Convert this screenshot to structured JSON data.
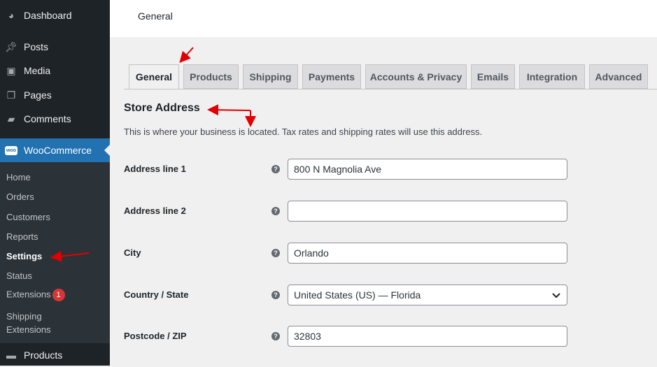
{
  "sidebar": {
    "menu": [
      {
        "label": "Dashboard",
        "icon": "dashboard-icon"
      },
      {
        "label": "Posts",
        "icon": "pin-icon"
      },
      {
        "label": "Media",
        "icon": "media-icon"
      },
      {
        "label": "Pages",
        "icon": "pages-icon"
      },
      {
        "label": "Comments",
        "icon": "comment-icon"
      },
      {
        "label": "WooCommerce",
        "icon": "woo-icon"
      }
    ],
    "submenu": [
      {
        "label": "Home"
      },
      {
        "label": "Orders"
      },
      {
        "label": "Customers"
      },
      {
        "label": "Reports"
      },
      {
        "label": "Settings"
      },
      {
        "label": "Status"
      },
      {
        "label": "Extensions",
        "badge": "1"
      },
      {
        "label": "Shipping Extensions"
      }
    ],
    "products": {
      "label": "Products",
      "icon": "archive-icon"
    },
    "active_color": "#2271b1"
  },
  "header": {
    "title": "General"
  },
  "tabs": [
    {
      "label": "General"
    },
    {
      "label": "Products"
    },
    {
      "label": "Shipping"
    },
    {
      "label": "Payments"
    },
    {
      "label": "Accounts & Privacy"
    },
    {
      "label": "Emails"
    },
    {
      "label": "Integration"
    },
    {
      "label": "Advanced"
    }
  ],
  "section": {
    "title": "Store Address",
    "description": "This is where your business is located. Tax rates and shipping rates will use this address."
  },
  "fields": [
    {
      "label": "Address line 1",
      "value": "800 N Magnolia Ave"
    },
    {
      "label": "Address line 2",
      "value": ""
    },
    {
      "label": "City",
      "value": "Orlando"
    },
    {
      "label": "Country / State",
      "value": "United States (US) — Florida"
    },
    {
      "label": "Postcode / ZIP",
      "value": "32803"
    }
  ],
  "help_glyph": "?",
  "annotation_color": "#e00000"
}
